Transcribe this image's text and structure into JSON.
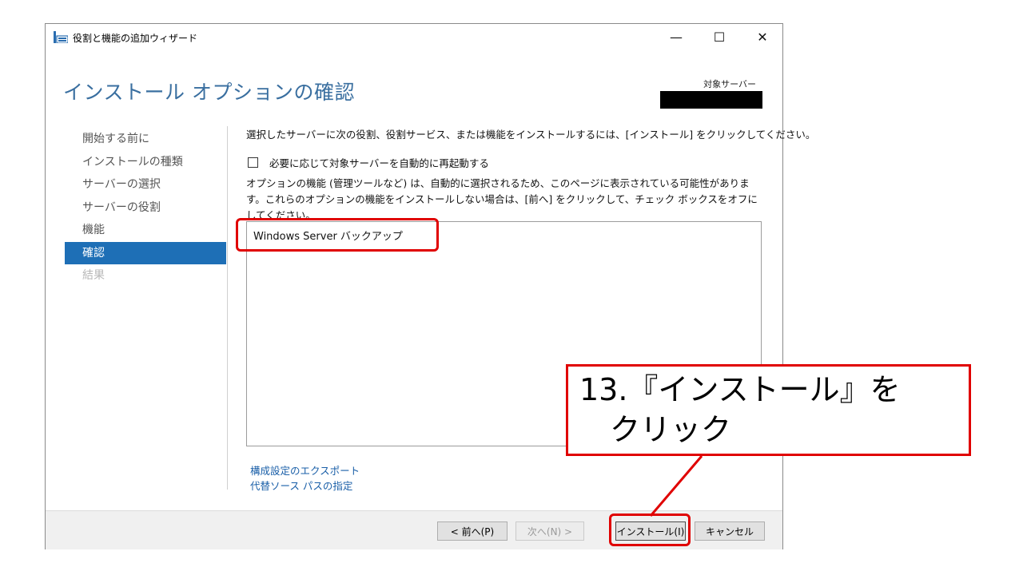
{
  "window": {
    "title": "役割と機能の追加ウィザード",
    "controls": {
      "minimize": "—",
      "maximize": "☐",
      "close": "✕"
    }
  },
  "header": {
    "title": "インストール オプションの確認",
    "target_server_label": "対象サーバー"
  },
  "nav": {
    "items": [
      {
        "label": "開始する前に",
        "state": "normal"
      },
      {
        "label": "インストールの種類",
        "state": "normal"
      },
      {
        "label": "サーバーの選択",
        "state": "normal"
      },
      {
        "label": "サーバーの役割",
        "state": "normal"
      },
      {
        "label": "機能",
        "state": "normal"
      },
      {
        "label": "確認",
        "state": "active"
      },
      {
        "label": "結果",
        "state": "disabled"
      }
    ]
  },
  "content": {
    "intro": "選択したサーバーに次の役割、役割サービス、または機能をインストールするには、[インストール] をクリックしてください。",
    "restart_checkbox": {
      "label": "必要に応じて対象サーバーを自動的に再起動する",
      "checked": false
    },
    "note": "オプションの機能 (管理ツールなど) は、自動的に選択されるため、このページに表示されている可能性があります。これらのオプションの機能をインストールしない場合は、[前へ] をクリックして、チェック ボックスをオフにしてください。",
    "features": [
      "Windows Server バックアップ"
    ],
    "links": {
      "export": "構成設定のエクスポート",
      "alternate_source": "代替ソース パスの指定"
    }
  },
  "footer": {
    "prev": "< 前へ(P)",
    "next": "次へ(N) >",
    "install": "インストール(I)",
    "cancel": "キャンセル"
  },
  "annotation": {
    "callout_text": "13.『インストール』を\n　クリック",
    "color": "#e00000"
  },
  "colors": {
    "accent": "#1e6fb6",
    "heading": "#3a6fa0",
    "link": "#1a5fa8"
  }
}
